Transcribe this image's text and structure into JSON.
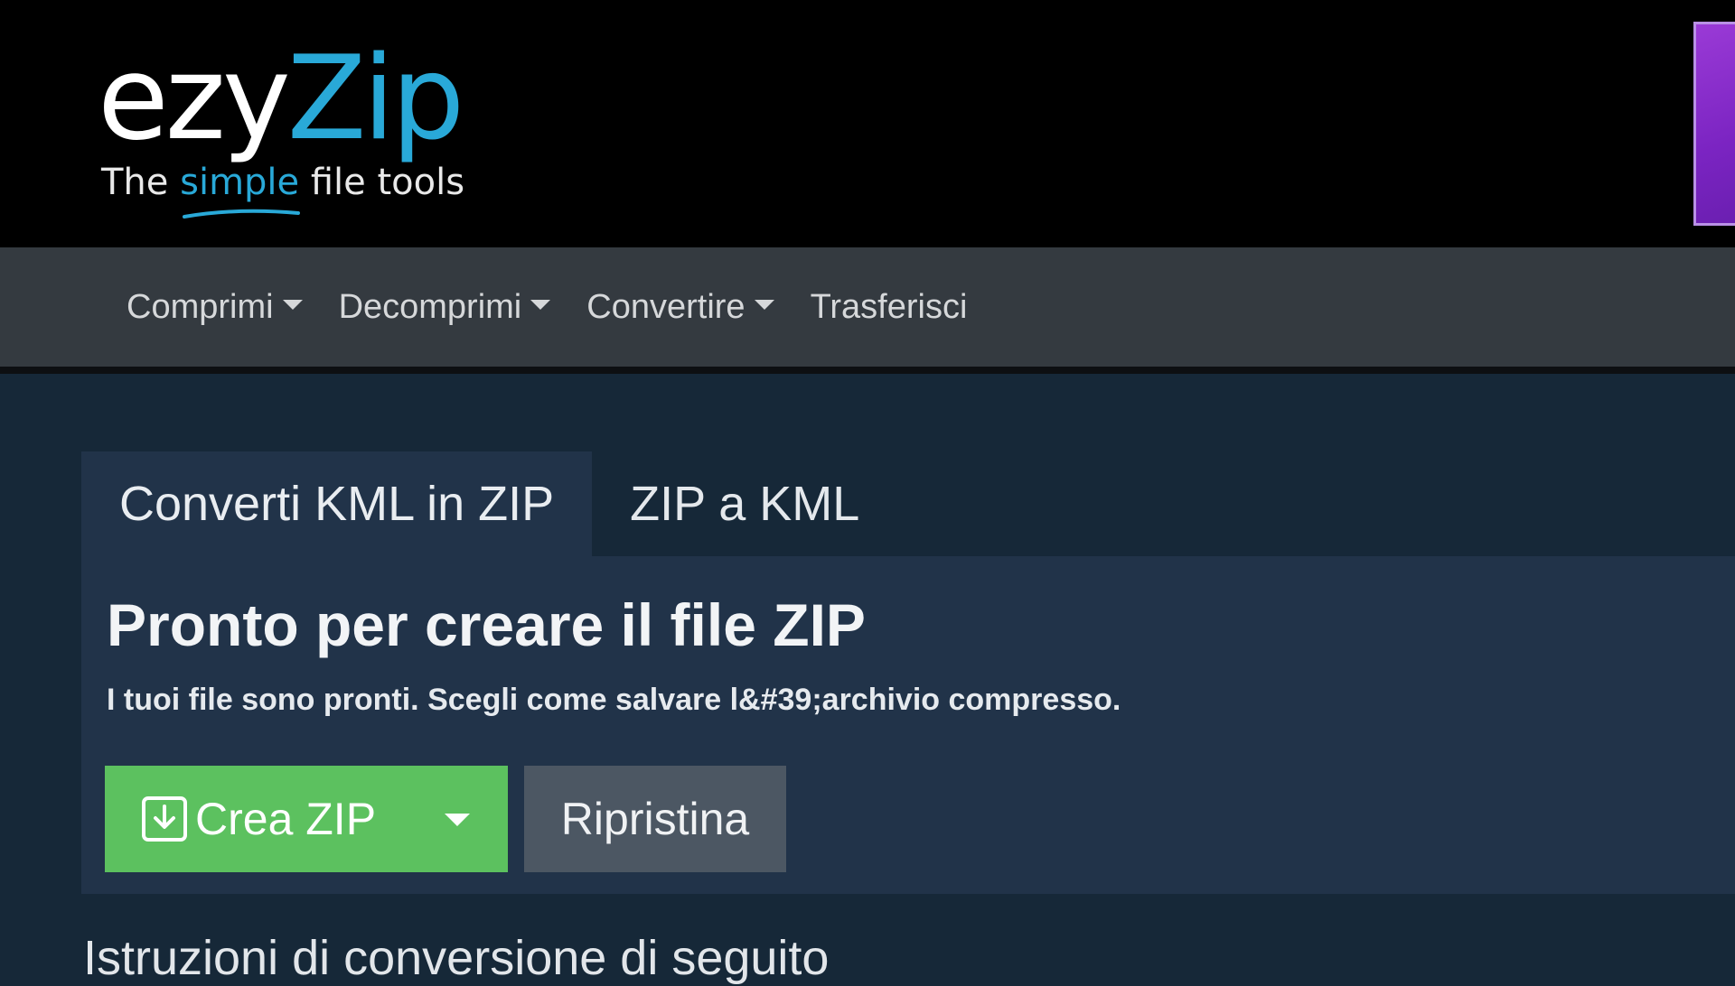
{
  "logo": {
    "name_part1": "ezy",
    "name_part2": "Zip",
    "tagline_before": "The ",
    "tagline_accent": "simple",
    "tagline_after": " file tools"
  },
  "nav": {
    "items": [
      {
        "label": "Comprimi",
        "dropdown": true
      },
      {
        "label": "Decomprimi",
        "dropdown": true
      },
      {
        "label": "Convertire",
        "dropdown": true
      },
      {
        "label": "Trasferisci",
        "dropdown": false
      }
    ]
  },
  "tabs": [
    {
      "label": "Converti KML in ZIP",
      "active": true
    },
    {
      "label": "ZIP a KML",
      "active": false
    }
  ],
  "panel": {
    "title": "Pronto per creare il file ZIP",
    "description": "I tuoi file sono pronti. Scegli come salvare l&#39;archivio compresso.",
    "create_button": {
      "label": "Crea ZIP",
      "icon": "download-icon"
    },
    "reset_button": {
      "label": "Ripristina"
    }
  },
  "instructions_heading": "Istruzioni di conversione di seguito",
  "colors": {
    "header_bg": "#000000",
    "brand_blue": "#29a9d8",
    "navbar_bg": "#343a40",
    "page_bg": "#162838",
    "panel_bg": "#213349",
    "create_green": "#5cc15f",
    "reset_gray": "#4c5763",
    "ad_purple": "#8a2fcc"
  }
}
